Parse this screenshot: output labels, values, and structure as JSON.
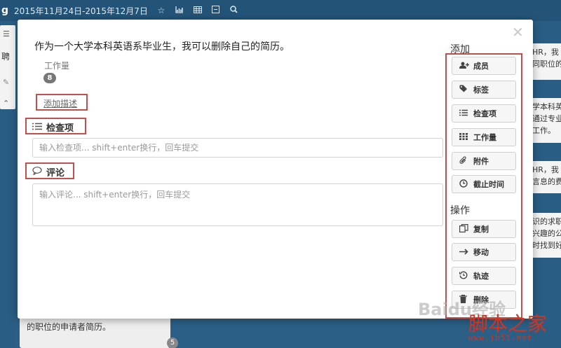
{
  "topbar": {
    "logo": "g",
    "date_range": "2015年11月24日-2015年12月7日"
  },
  "background": {
    "left_card_text": "聘",
    "list_card_text": "的职位的申请者简历。",
    "list_card_badge": "5",
    "right_cards": [
      {
        "lines": [
          "HR，我",
          "同职位的"
        ]
      },
      {
        "lines": [
          "学本科英",
          "通过专业",
          "工作。"
        ]
      },
      {
        "lines": [
          "HR，我",
          "言息的费"
        ]
      },
      {
        "lines": [
          "识的求职",
          "兴趣的公",
          "时找到好"
        ]
      }
    ]
  },
  "modal": {
    "title": "作为一个大学本科英语系毕业生，我可以删除自己的简历。",
    "workload_label": "工作量",
    "workload_value": "8",
    "add_description": "添加描述",
    "checklist": {
      "heading": "检查项",
      "placeholder": "输入检查项... shift+enter换行，回车提交"
    },
    "comments": {
      "heading": "评论",
      "placeholder": "输入评论... shift+enter换行，回车提交"
    }
  },
  "sidebar": {
    "add_heading": "添加",
    "add_buttons": [
      {
        "label": "成员",
        "icon": "add-user-icon"
      },
      {
        "label": "标签",
        "icon": "tag-icon"
      },
      {
        "label": "检查项",
        "icon": "list-icon"
      },
      {
        "label": "工作量",
        "icon": "grid-icon"
      },
      {
        "label": "附件",
        "icon": "paperclip-icon"
      },
      {
        "label": "截止时间",
        "icon": "clock-icon"
      }
    ],
    "ops_heading": "操作",
    "op_buttons": [
      {
        "label": "复制",
        "icon": "copy-icon"
      },
      {
        "label": "移动",
        "icon": "arrow-right-icon"
      },
      {
        "label": "轨迹",
        "icon": "history-icon"
      },
      {
        "label": "删除",
        "icon": "trash-icon"
      }
    ]
  },
  "watermarks": {
    "baidu": "Baidu经验",
    "site_name": "脚本之家",
    "site_url": "www.jb51.net"
  },
  "colors": {
    "highlight": "#c0504d",
    "board_bg": "#2b5f86",
    "topbar_bg": "#235478"
  }
}
